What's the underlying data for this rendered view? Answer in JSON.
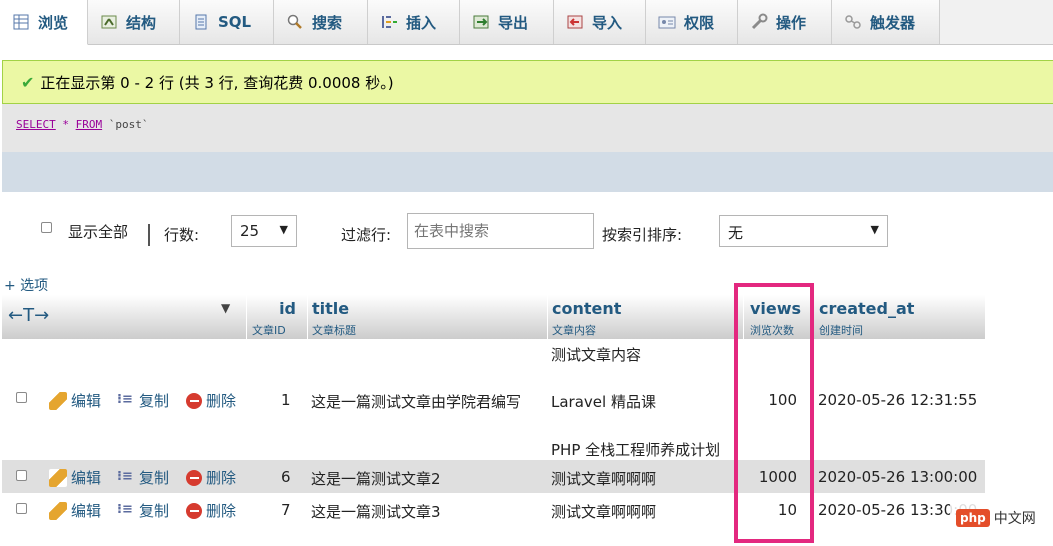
{
  "tabs": [
    {
      "label": "浏览",
      "icon": "browse-icon",
      "active": true
    },
    {
      "label": "结构",
      "icon": "structure-icon"
    },
    {
      "label": "SQL",
      "icon": "sql-icon"
    },
    {
      "label": "搜索",
      "icon": "search-icon"
    },
    {
      "label": "插入",
      "icon": "insert-icon"
    },
    {
      "label": "导出",
      "icon": "export-icon"
    },
    {
      "label": "导入",
      "icon": "import-icon"
    },
    {
      "label": "权限",
      "icon": "privileges-icon"
    },
    {
      "label": "操作",
      "icon": "operations-icon"
    },
    {
      "label": "触发器",
      "icon": "triggers-icon"
    }
  ],
  "message": {
    "text": "正在显示第 0 - 2 行 (共 3 行, 查询花费 0.0008 秒。)"
  },
  "sql": {
    "kw1": "SELECT",
    "star": "*",
    "kw2": "FROM",
    "table": "`post`"
  },
  "nav": {
    "show_all": "显示全部",
    "rows_label": "行数:",
    "rows_value": "25",
    "filter_label": "过滤行:",
    "filter_placeholder": "在表中搜索",
    "sort_label": "按索引排序:",
    "sort_value": "无"
  },
  "options_link": "+ 选项",
  "table": {
    "arrows": "←T→",
    "columns": [
      {
        "name": "id",
        "comment": "文章ID"
      },
      {
        "name": "title",
        "comment": "文章标题"
      },
      {
        "name": "content",
        "comment": "文章内容"
      },
      {
        "name": "views",
        "comment": "浏览次数"
      },
      {
        "name": "created_at",
        "comment": "创建时间"
      }
    ],
    "actions": {
      "edit": "编辑",
      "copy": "复制",
      "delete": "删除"
    },
    "rows": [
      {
        "id": "1",
        "title": "这是一篇测试文章由学院君编写",
        "content": [
          "测试文章内容",
          "Laravel 精品课",
          "PHP 全栈工程师养成计划"
        ],
        "views": "100",
        "created_at": "2020-05-26 12:31:55"
      },
      {
        "id": "6",
        "title": "这是一篇测试文章2",
        "content": [
          "测试文章啊啊啊"
        ],
        "views": "1000",
        "created_at": "2020-05-26 13:00:00"
      },
      {
        "id": "7",
        "title": "这是一篇测试文章3",
        "content": [
          "测试文章啊啊啊"
        ],
        "views": "10",
        "created_at": "2020-05-26 13:30:00"
      }
    ]
  },
  "watermark": {
    "logo": "php",
    "text": "中文网"
  },
  "colors": {
    "link": "#235a81",
    "success_bg": "#ebf8a4",
    "highlight": "#e3287f"
  }
}
